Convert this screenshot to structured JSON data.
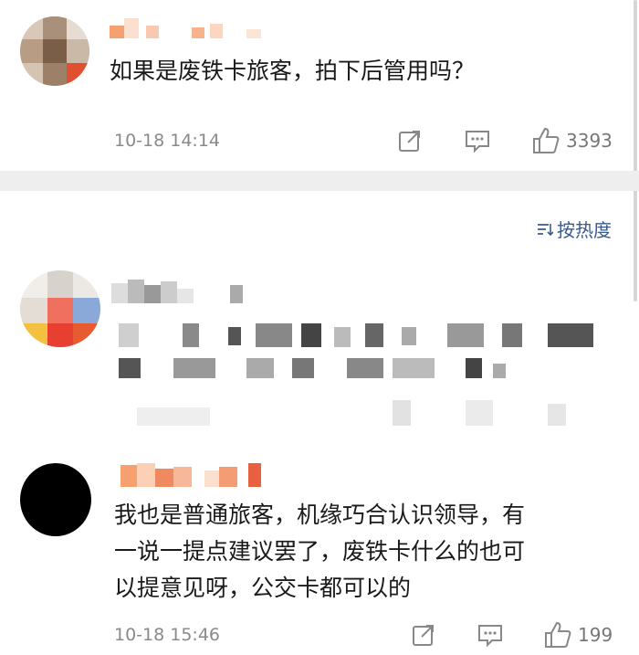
{
  "comments": [
    {
      "text": "如果是废铁卡旅客，拍下后管用吗？",
      "time": "10-18 14:14",
      "likes": "3393"
    },
    {
      "text": "",
      "time": "",
      "likes": ""
    },
    {
      "text_lines": [
        "我也是普通旅客，机缘巧合认识领导，有",
        "一说一提点建议罢了，废铁卡什么的也可",
        "以提意见呀，公交卡都可以的"
      ],
      "time": "10-18 15:46",
      "likes": "199"
    }
  ],
  "sort": {
    "label": "按热度"
  },
  "icons": {
    "share": "share-icon",
    "comment": "comment-icon",
    "like": "like-icon",
    "sort": "sort-icon"
  },
  "colors": {
    "sort_link": "#3a5a8c",
    "meta": "#8a8a8a"
  }
}
